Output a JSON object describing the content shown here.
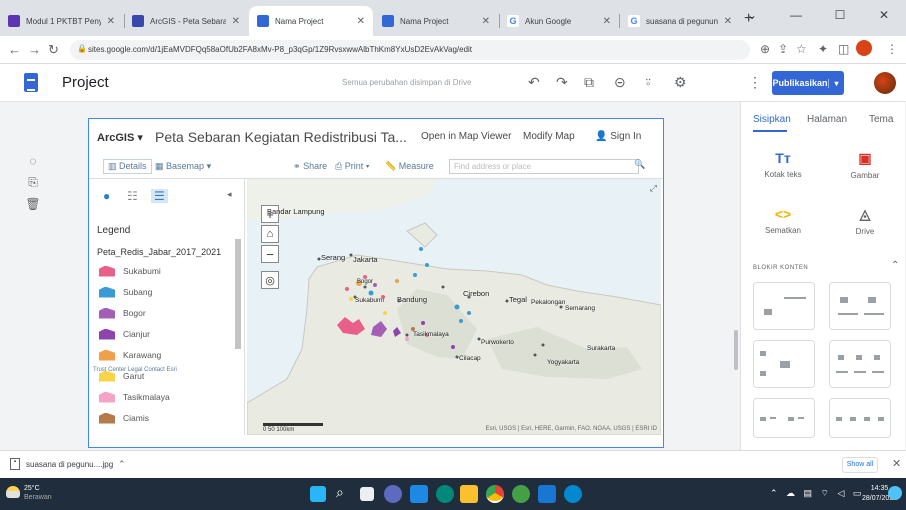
{
  "browser": {
    "tabs": [
      {
        "title": "Modul 1 PKTBT Peny",
        "fav": "#5e35b1"
      },
      {
        "title": "ArcGIS - Peta Sebaran",
        "fav": "#3949ab"
      },
      {
        "title": "Nama Project",
        "fav": "#3367d6"
      },
      {
        "title": "Nama Project",
        "fav": "#3367d6"
      },
      {
        "title": "Akun Google",
        "fav": "#4285f4"
      },
      {
        "title": "suasana di pegunung",
        "fav": "#4285f4"
      }
    ],
    "url": "sites.google.com/d/1jEaMVDFQq58aOfUb2FA8xMv-P8_p3qGp/1Z9RvsxwwAlbThKm8YxUsD2EvAkVag/edit",
    "window_controls": [
      "minimize-icon",
      "maximize-icon",
      "close-icon"
    ]
  },
  "sites": {
    "title": "Project",
    "saved_status": "Semua perubahan disimpan di Drive",
    "publish_label": "Publikasikan"
  },
  "map_embed": {
    "brand": "ArcGIS",
    "title": "Peta Sebaran Kegiatan Redistribusi Ta...",
    "header_links": [
      "Open in Map Viewer",
      "Modify Map",
      "Sign In"
    ],
    "toolbar": {
      "details": "Details",
      "basemap": "Basemap",
      "share": "Share",
      "print": "Print",
      "measure": "Measure",
      "find_placeholder": "Find address or place"
    },
    "legend_title": "Legend",
    "layer_name": "Peta_Redis_Jabar_2017_2021",
    "legend_items": [
      {
        "label": "Sukabumi",
        "color": "#e8608a"
      },
      {
        "label": "Subang",
        "color": "#3a9bd5"
      },
      {
        "label": "Bogor",
        "color": "#a35fb5"
      },
      {
        "label": "Cianjur",
        "color": "#8e44ad"
      },
      {
        "label": "Karawang",
        "color": "#f0a04b"
      },
      {
        "label": "Garut",
        "color": "#f7d44a"
      },
      {
        "label": "Tasikmalaya",
        "color": "#f5a3c7"
      },
      {
        "label": "Ciamis",
        "color": "#b57a4a"
      }
    ],
    "footer_links": "Trust Center   Legal   Contact Esri",
    "place_labels": [
      {
        "name": "Bandar Lampung"
      },
      {
        "name": "Serang"
      },
      {
        "name": "Jakarta"
      },
      {
        "name": "Bogor"
      },
      {
        "name": "Sukabumi"
      },
      {
        "name": "Bandung"
      },
      {
        "name": "Cirebon"
      },
      {
        "name": "Tegal"
      },
      {
        "name": "Pekalongan"
      },
      {
        "name": "Semarang"
      },
      {
        "name": "Tasikmalaya"
      },
      {
        "name": "Purwokerto"
      },
      {
        "name": "Cilacap"
      },
      {
        "name": "Surakarta"
      },
      {
        "name": "Yogyakarta"
      }
    ],
    "scale_label": "0    50    100km",
    "attribution": "Esri, USGS | Esri, HERE, Garmin, FAO, NOAA, USGS | ESRI ID"
  },
  "right_panel": {
    "tabs": [
      "Sisipkan",
      "Halaman",
      "Tema"
    ],
    "insert_items": [
      {
        "label": "Kotak teks",
        "icon": "text-box-icon"
      },
      {
        "label": "Gambar",
        "icon": "image-icon"
      },
      {
        "label": "Sematkan",
        "icon": "embed-icon"
      },
      {
        "label": "Drive",
        "icon": "drive-icon"
      }
    ],
    "blocks_header": "BLOKIR KONTEN"
  },
  "download": {
    "file": "suasana di pegunu....jpg",
    "show_all": "Show all"
  },
  "taskbar": {
    "weather_temp": "25°C",
    "weather_desc": "Berawan",
    "time": "14:35",
    "date": "28/07/2022"
  }
}
